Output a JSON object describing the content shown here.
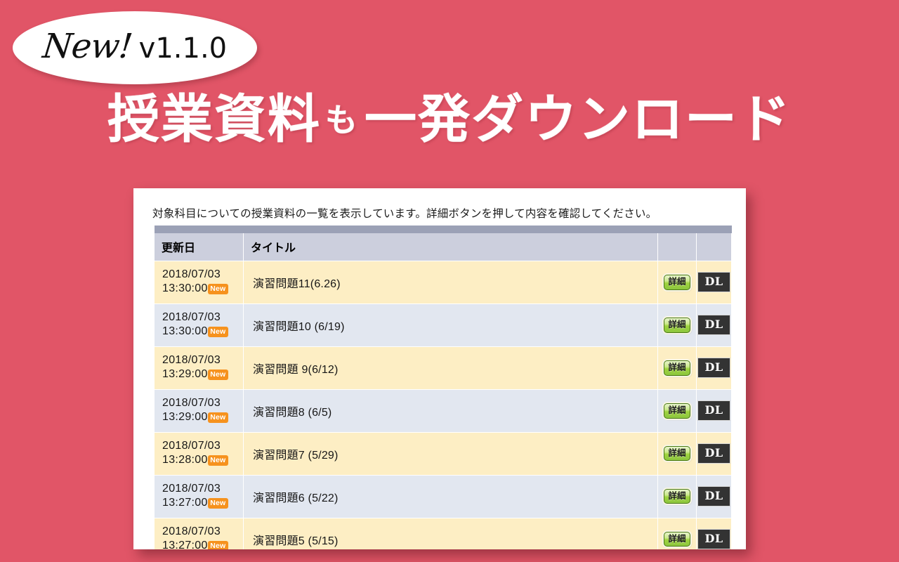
{
  "theme": {
    "background_pink": "#e15567",
    "card_white": "#ffffff",
    "header_bar_dark": "#9ba1b6",
    "header_cell": "#cccfdd",
    "row_odd": "#fdeec4",
    "row_even": "#e2e7f0",
    "badge_orange": "#f6921e",
    "detail_green": "#8cc63e",
    "dl_dark": "#333333"
  },
  "badge": {
    "new_word": "New!",
    "version": "v1.1.0"
  },
  "headline": {
    "part1": "授業資料",
    "particle": "も",
    "part2": "一発ダウンロード"
  },
  "card": {
    "description": "対象科目についての授業資料の一覧を表示しています。詳細ボタンを押して内容を確認してください。"
  },
  "table": {
    "columns": [
      {
        "key": "date",
        "label": "更新日"
      },
      {
        "key": "title",
        "label": "タイトル"
      },
      {
        "key": "detail",
        "label": ""
      },
      {
        "key": "dl",
        "label": ""
      }
    ],
    "detail_button_label": "詳細",
    "dl_button_label": "DL",
    "new_badge_label": "New",
    "rows": [
      {
        "date_date": "2018/07/03",
        "date_time": "13:30:00",
        "is_new": true,
        "title": "演習問題11(6.26)",
        "detail": "詳細",
        "dl": "DL"
      },
      {
        "date_date": "2018/07/03",
        "date_time": "13:30:00",
        "is_new": true,
        "title": "演習問題10 (6/19)",
        "detail": "詳細",
        "dl": "DL"
      },
      {
        "date_date": "2018/07/03",
        "date_time": "13:29:00",
        "is_new": true,
        "title": "演習問題 9(6/12)",
        "detail": "詳細",
        "dl": "DL"
      },
      {
        "date_date": "2018/07/03",
        "date_time": "13:29:00",
        "is_new": true,
        "title": "演習問題8 (6/5)",
        "detail": "詳細",
        "dl": "DL"
      },
      {
        "date_date": "2018/07/03",
        "date_time": "13:28:00",
        "is_new": true,
        "title": "演習問題7 (5/29)",
        "detail": "詳細",
        "dl": "DL"
      },
      {
        "date_date": "2018/07/03",
        "date_time": "13:27:00",
        "is_new": true,
        "title": "演習問題6  (5/22)",
        "detail": "詳細",
        "dl": "DL"
      },
      {
        "date_date": "2018/07/03",
        "date_time": "13:27:00",
        "is_new": true,
        "title": "演習問題5 (5/15)",
        "detail": "詳細",
        "dl": "DL"
      }
    ]
  }
}
